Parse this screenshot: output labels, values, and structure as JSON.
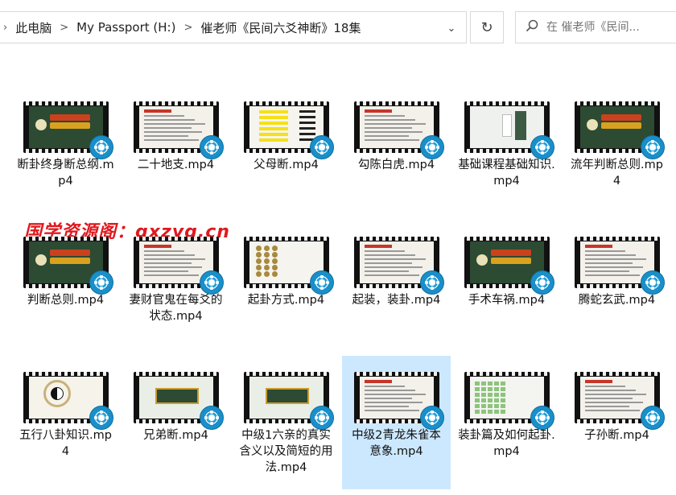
{
  "address_bar": {
    "crumbs": [
      "此电脑",
      "My Passport (H:)",
      "催老师《民间六爻神断》18集"
    ],
    "separator": ">",
    "dropdown_glyph": "⌄"
  },
  "refresh_glyph": "↻",
  "search": {
    "placeholder": "在 催老师《民间...",
    "icon": "search-icon"
  },
  "watermark": "国学资源阁：gxzyg.cn",
  "files": [
    {
      "name": "断卦终身断总纲.mp4",
      "thumb": "green",
      "selected": false
    },
    {
      "name": "二十地支.mp4",
      "thumb": "doc",
      "selected": false
    },
    {
      "name": "父母断.mp4",
      "thumb": "yellow",
      "selected": false
    },
    {
      "name": "勾陈白虎.mp4",
      "thumb": "doc",
      "selected": false
    },
    {
      "name": "基础课程基础知识.mp4",
      "thumb": "pale",
      "selected": false
    },
    {
      "name": "流年判断总则.mp4",
      "thumb": "green",
      "selected": false
    },
    {
      "name": "判断总则.mp4",
      "thumb": "green",
      "selected": false
    },
    {
      "name": "妻财官鬼在每爻的状态.mp4",
      "thumb": "doc",
      "selected": false
    },
    {
      "name": "起卦方式.mp4",
      "thumb": "coins",
      "selected": false
    },
    {
      "name": "起装，装卦.mp4",
      "thumb": "doc",
      "selected": false
    },
    {
      "name": "手术车祸.mp4",
      "thumb": "green",
      "selected": false
    },
    {
      "name": "腾蛇玄武.mp4",
      "thumb": "doc",
      "selected": false
    },
    {
      "name": "五行八卦知识.mp4",
      "thumb": "bagua",
      "selected": false
    },
    {
      "name": "兄弟断.mp4",
      "thumb": "title",
      "selected": false
    },
    {
      "name": "中级1六亲的真实含义以及简短的用法.mp4",
      "thumb": "title",
      "selected": false
    },
    {
      "name": "中级2青龙朱雀本意象.mp4",
      "thumb": "doc",
      "selected": true
    },
    {
      "name": "装卦篇及如何起卦.mp4",
      "thumb": "grid",
      "selected": false
    },
    {
      "name": "子孙断.mp4",
      "thumb": "doc",
      "selected": false
    }
  ],
  "colors": {
    "selection": "#cce8ff",
    "watermark": "#e0181e",
    "reel": "#26a1da"
  }
}
